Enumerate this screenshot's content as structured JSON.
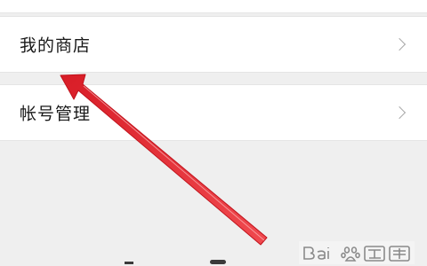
{
  "menu": {
    "items": [
      {
        "label": "我的商店"
      },
      {
        "label": "帐号管理"
      }
    ]
  },
  "colors": {
    "background": "#efefef",
    "row": "#ffffff",
    "pointer": "#e8232c",
    "chevron": "#a8a8a8"
  },
  "icons": [
    "chevron-right-icon",
    "red-arrow-annotation",
    "baidu-watermark"
  ]
}
